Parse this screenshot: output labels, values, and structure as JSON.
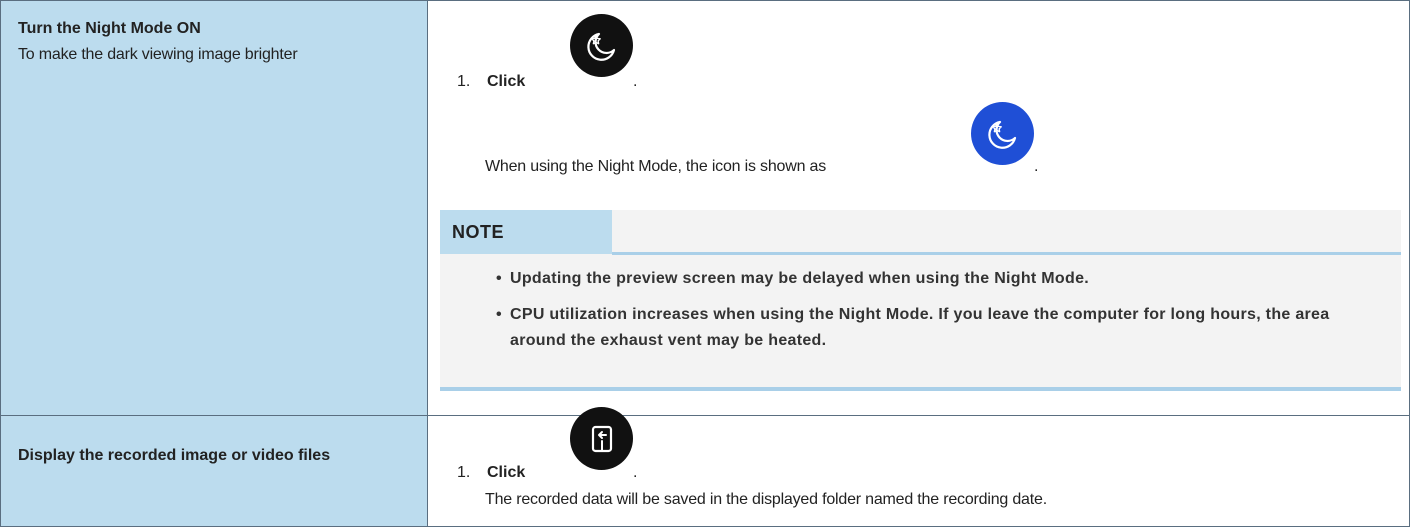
{
  "rows": [
    {
      "title": "Turn the Night Mode ON",
      "description": "To make the dark viewing image brighter",
      "step": {
        "number": "1.",
        "action": "Click",
        "icon": "night-mode-icon",
        "end": "."
      },
      "result_text": "When using the Night Mode, the icon is shown as",
      "result_icon": "night-mode-active-icon",
      "result_end": ".",
      "note": {
        "heading": "NOTE",
        "items": [
          "Updating the preview screen may be delayed when using the Night Mode.",
          "CPU utilization increases when using the Night Mode. If you leave the computer for long hours, the area around the exhaust vent may be heated."
        ]
      }
    },
    {
      "title": "Display the recorded image or video files",
      "step": {
        "number": "1.",
        "action": "Click",
        "icon": "open-folder-icon",
        "end": "."
      },
      "result_text": "The recorded data will be saved in the displayed folder named the recording date."
    }
  ],
  "colors": {
    "left_cell_bg": "#bcdcee",
    "border": "#5a6e80",
    "note_bg": "#f3f3f3",
    "note_accent": "#a9cfe8",
    "icon_dark": "#111111",
    "icon_active": "#1f4fd6"
  }
}
